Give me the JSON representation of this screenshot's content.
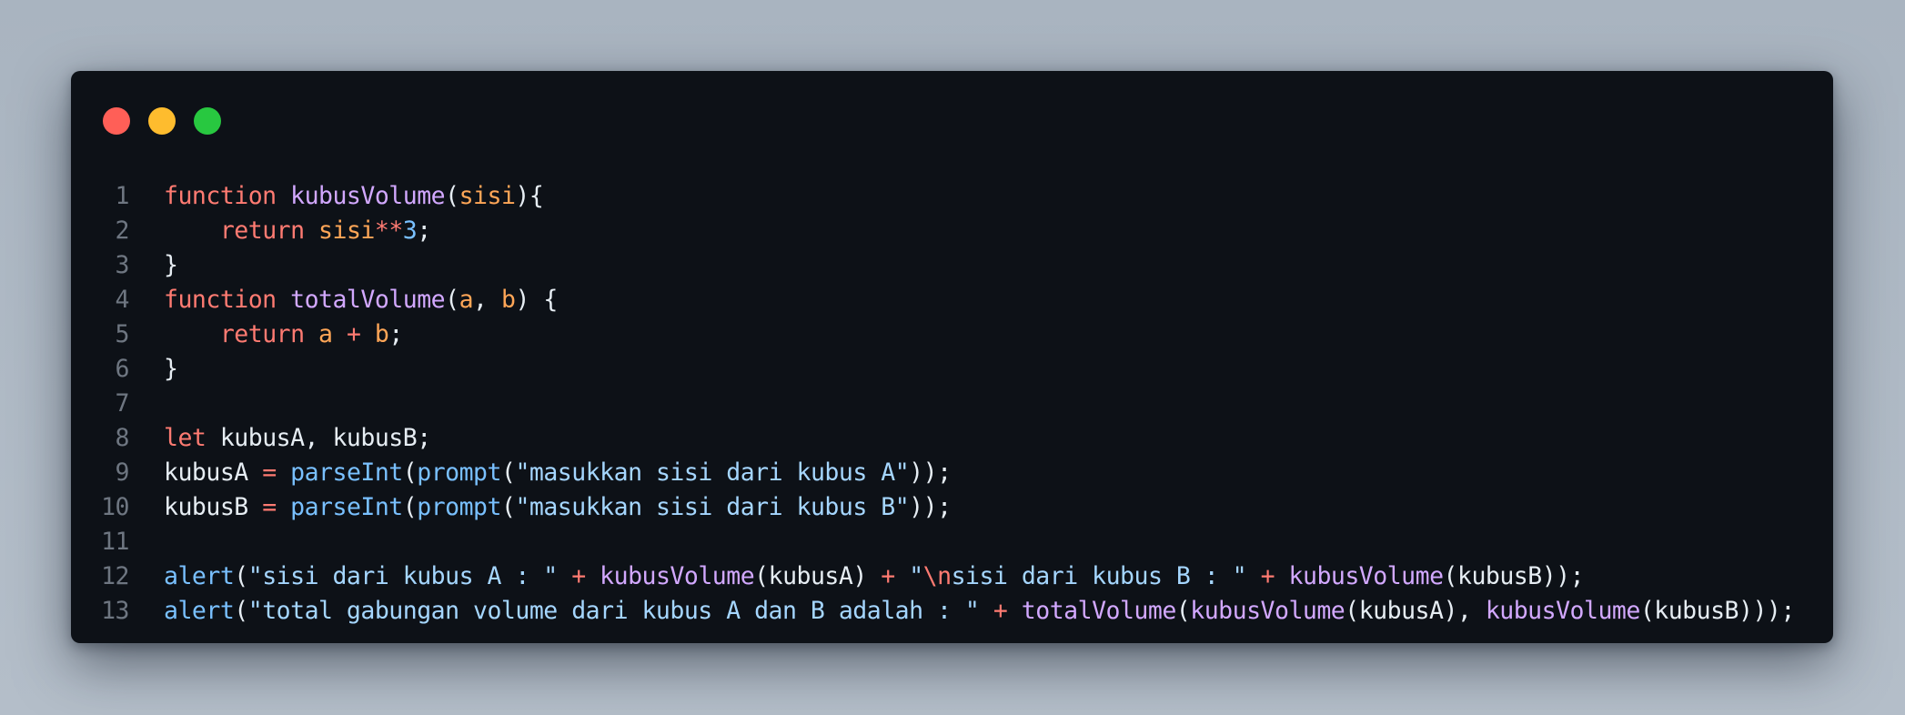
{
  "window": {
    "controls": [
      "close",
      "minimize",
      "zoom"
    ],
    "colors": {
      "background": "#0d1117",
      "close": "#ff5f57",
      "minimize": "#febc2e",
      "zoom": "#28c840"
    }
  },
  "code": {
    "language": "javascript",
    "lines": [
      {
        "number": "1",
        "tokens": [
          {
            "t": "function",
            "k": "kw"
          },
          {
            "t": " ",
            "k": "plain"
          },
          {
            "t": "kubusVolume",
            "k": "fn"
          },
          {
            "t": "(",
            "k": "plain"
          },
          {
            "t": "sisi",
            "k": "param"
          },
          {
            "t": "){",
            "k": "plain"
          }
        ]
      },
      {
        "number": "2",
        "tokens": [
          {
            "t": "    ",
            "k": "plain"
          },
          {
            "t": "return",
            "k": "kw"
          },
          {
            "t": " ",
            "k": "plain"
          },
          {
            "t": "sisi",
            "k": "param"
          },
          {
            "t": "**",
            "k": "op"
          },
          {
            "t": "3",
            "k": "num"
          },
          {
            "t": ";",
            "k": "plain"
          }
        ]
      },
      {
        "number": "3",
        "tokens": [
          {
            "t": "}",
            "k": "plain"
          }
        ]
      },
      {
        "number": "4",
        "tokens": [
          {
            "t": "function",
            "k": "kw"
          },
          {
            "t": " ",
            "k": "plain"
          },
          {
            "t": "totalVolume",
            "k": "fn"
          },
          {
            "t": "(",
            "k": "plain"
          },
          {
            "t": "a",
            "k": "param"
          },
          {
            "t": ", ",
            "k": "plain"
          },
          {
            "t": "b",
            "k": "param"
          },
          {
            "t": ") {",
            "k": "plain"
          }
        ]
      },
      {
        "number": "5",
        "tokens": [
          {
            "t": "    ",
            "k": "plain"
          },
          {
            "t": "return",
            "k": "kw"
          },
          {
            "t": " ",
            "k": "plain"
          },
          {
            "t": "a",
            "k": "param"
          },
          {
            "t": " ",
            "k": "plain"
          },
          {
            "t": "+",
            "k": "op"
          },
          {
            "t": " ",
            "k": "plain"
          },
          {
            "t": "b",
            "k": "param"
          },
          {
            "t": ";",
            "k": "plain"
          }
        ]
      },
      {
        "number": "6",
        "tokens": [
          {
            "t": "}",
            "k": "plain"
          }
        ]
      },
      {
        "number": "7",
        "tokens": []
      },
      {
        "number": "8",
        "tokens": [
          {
            "t": "let",
            "k": "kw"
          },
          {
            "t": " kubusA, kubusB;",
            "k": "plain"
          }
        ]
      },
      {
        "number": "9",
        "tokens": [
          {
            "t": "kubusA ",
            "k": "plain"
          },
          {
            "t": "=",
            "k": "op"
          },
          {
            "t": " ",
            "k": "plain"
          },
          {
            "t": "parseInt",
            "k": "builtin"
          },
          {
            "t": "(",
            "k": "plain"
          },
          {
            "t": "prompt",
            "k": "builtin"
          },
          {
            "t": "(",
            "k": "plain"
          },
          {
            "t": "\"masukkan sisi dari kubus A\"",
            "k": "str"
          },
          {
            "t": "));",
            "k": "plain"
          }
        ]
      },
      {
        "number": "10",
        "tokens": [
          {
            "t": "kubusB ",
            "k": "plain"
          },
          {
            "t": "=",
            "k": "op"
          },
          {
            "t": " ",
            "k": "plain"
          },
          {
            "t": "parseInt",
            "k": "builtin"
          },
          {
            "t": "(",
            "k": "plain"
          },
          {
            "t": "prompt",
            "k": "builtin"
          },
          {
            "t": "(",
            "k": "plain"
          },
          {
            "t": "\"masukkan sisi dari kubus B\"",
            "k": "str"
          },
          {
            "t": "));",
            "k": "plain"
          }
        ]
      },
      {
        "number": "11",
        "tokens": []
      },
      {
        "number": "12",
        "tokens": [
          {
            "t": "alert",
            "k": "builtin"
          },
          {
            "t": "(",
            "k": "plain"
          },
          {
            "t": "\"sisi dari kubus A : \"",
            "k": "str"
          },
          {
            "t": " ",
            "k": "plain"
          },
          {
            "t": "+",
            "k": "op"
          },
          {
            "t": " ",
            "k": "plain"
          },
          {
            "t": "kubusVolume",
            "k": "fn"
          },
          {
            "t": "(kubusA) ",
            "k": "plain"
          },
          {
            "t": "+",
            "k": "op"
          },
          {
            "t": " ",
            "k": "plain"
          },
          {
            "t": "\"",
            "k": "str"
          },
          {
            "t": "\\n",
            "k": "esc"
          },
          {
            "t": "sisi dari kubus B : \"",
            "k": "str"
          },
          {
            "t": " ",
            "k": "plain"
          },
          {
            "t": "+",
            "k": "op"
          },
          {
            "t": " ",
            "k": "plain"
          },
          {
            "t": "kubusVolume",
            "k": "fn"
          },
          {
            "t": "(kubusB));",
            "k": "plain"
          }
        ]
      },
      {
        "number": "13",
        "tokens": [
          {
            "t": "alert",
            "k": "builtin"
          },
          {
            "t": "(",
            "k": "plain"
          },
          {
            "t": "\"total gabungan volume dari kubus A dan B adalah : \"",
            "k": "str"
          },
          {
            "t": " ",
            "k": "plain"
          },
          {
            "t": "+",
            "k": "op"
          },
          {
            "t": " ",
            "k": "plain"
          },
          {
            "t": "totalVolume",
            "k": "fn"
          },
          {
            "t": "(",
            "k": "plain"
          },
          {
            "t": "kubusVolume",
            "k": "fn"
          },
          {
            "t": "(kubusA), ",
            "k": "plain"
          },
          {
            "t": "kubusVolume",
            "k": "fn"
          },
          {
            "t": "(kubusB)));",
            "k": "plain"
          }
        ]
      }
    ]
  }
}
